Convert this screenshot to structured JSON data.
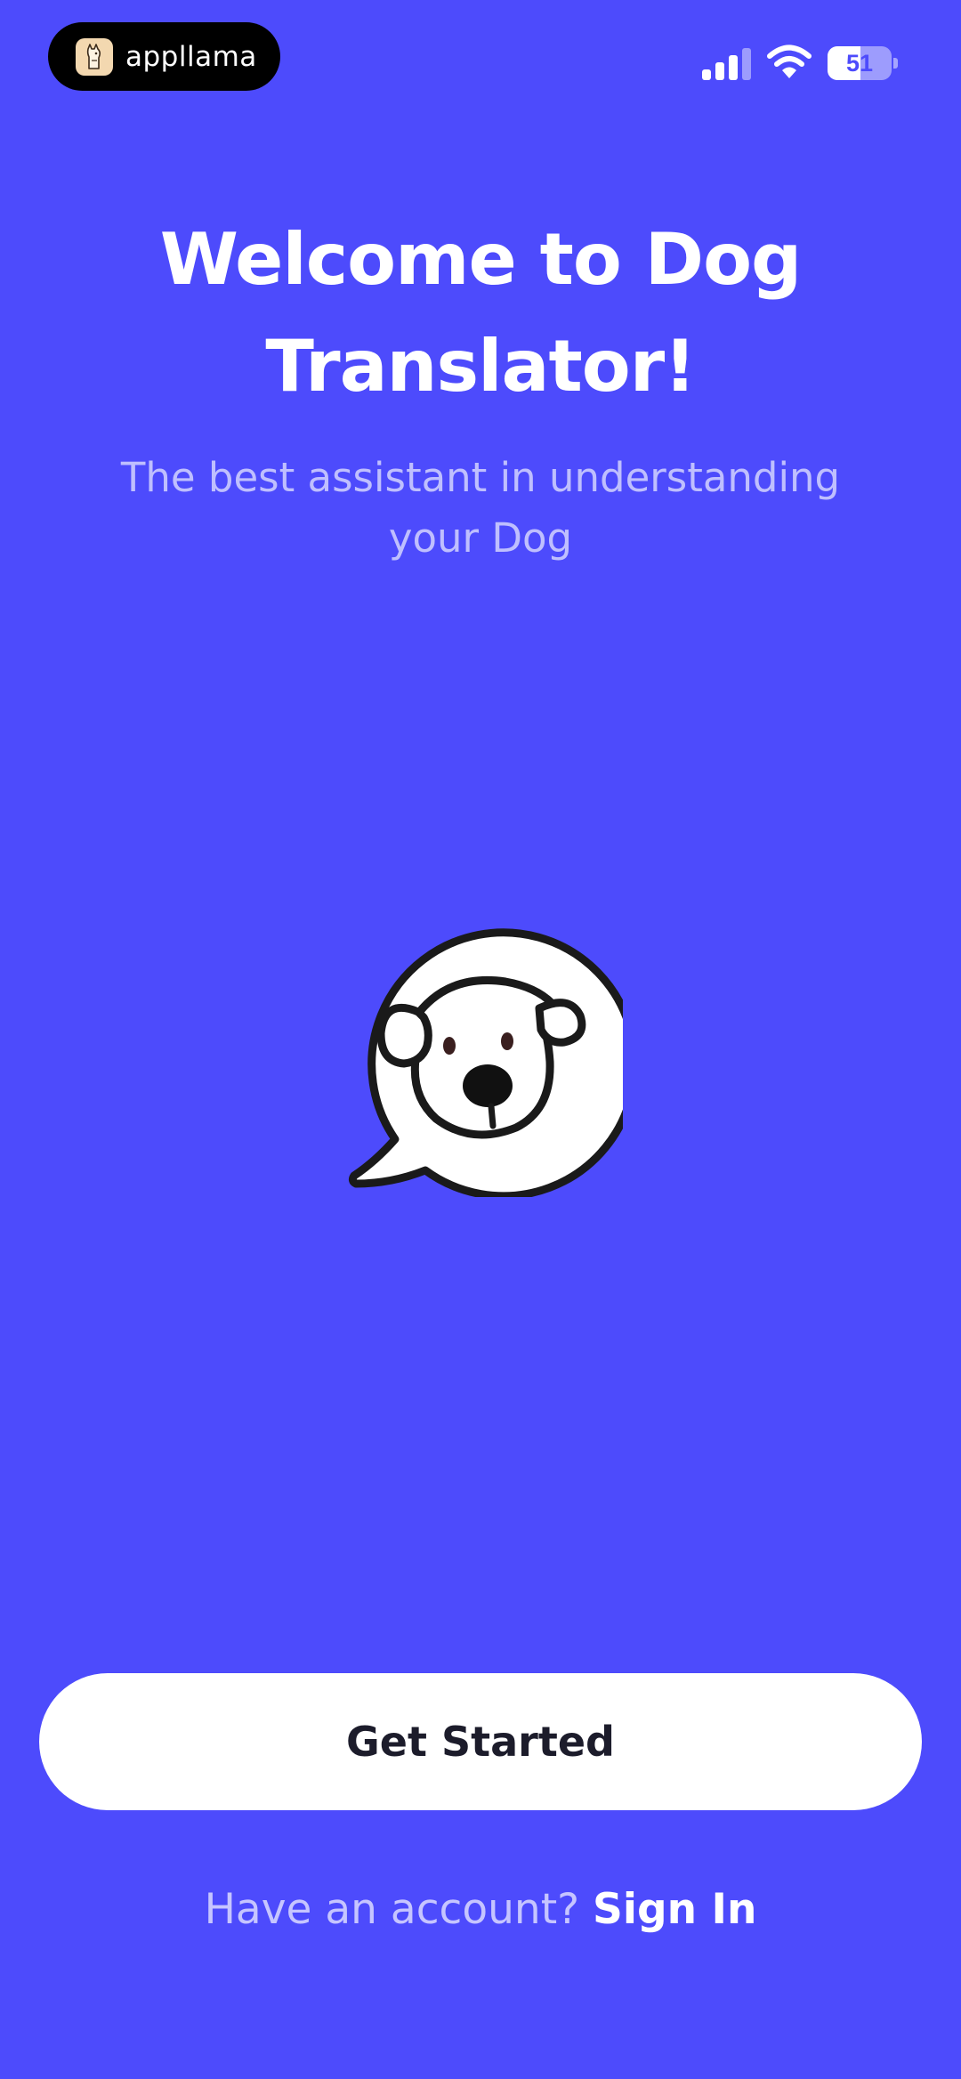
{
  "status_bar": {
    "brand_name": "appllama",
    "battery_level": "51",
    "battery_percent": 51,
    "signal_icon": "cellular-signal-icon",
    "wifi_icon": "wifi-icon"
  },
  "welcome": {
    "title": "Welcome to Dog Translator!",
    "subtitle": "The best assistant in understanding your Dog",
    "illustration_icon": "dog-speech-bubble-icon"
  },
  "actions": {
    "get_started_label": "Get Started",
    "account_prompt": "Have an account?",
    "sign_in_label": "Sign In"
  },
  "colors": {
    "background": "#4d4bfc",
    "button_background": "#ffffff",
    "button_text": "#1c1c2b"
  }
}
